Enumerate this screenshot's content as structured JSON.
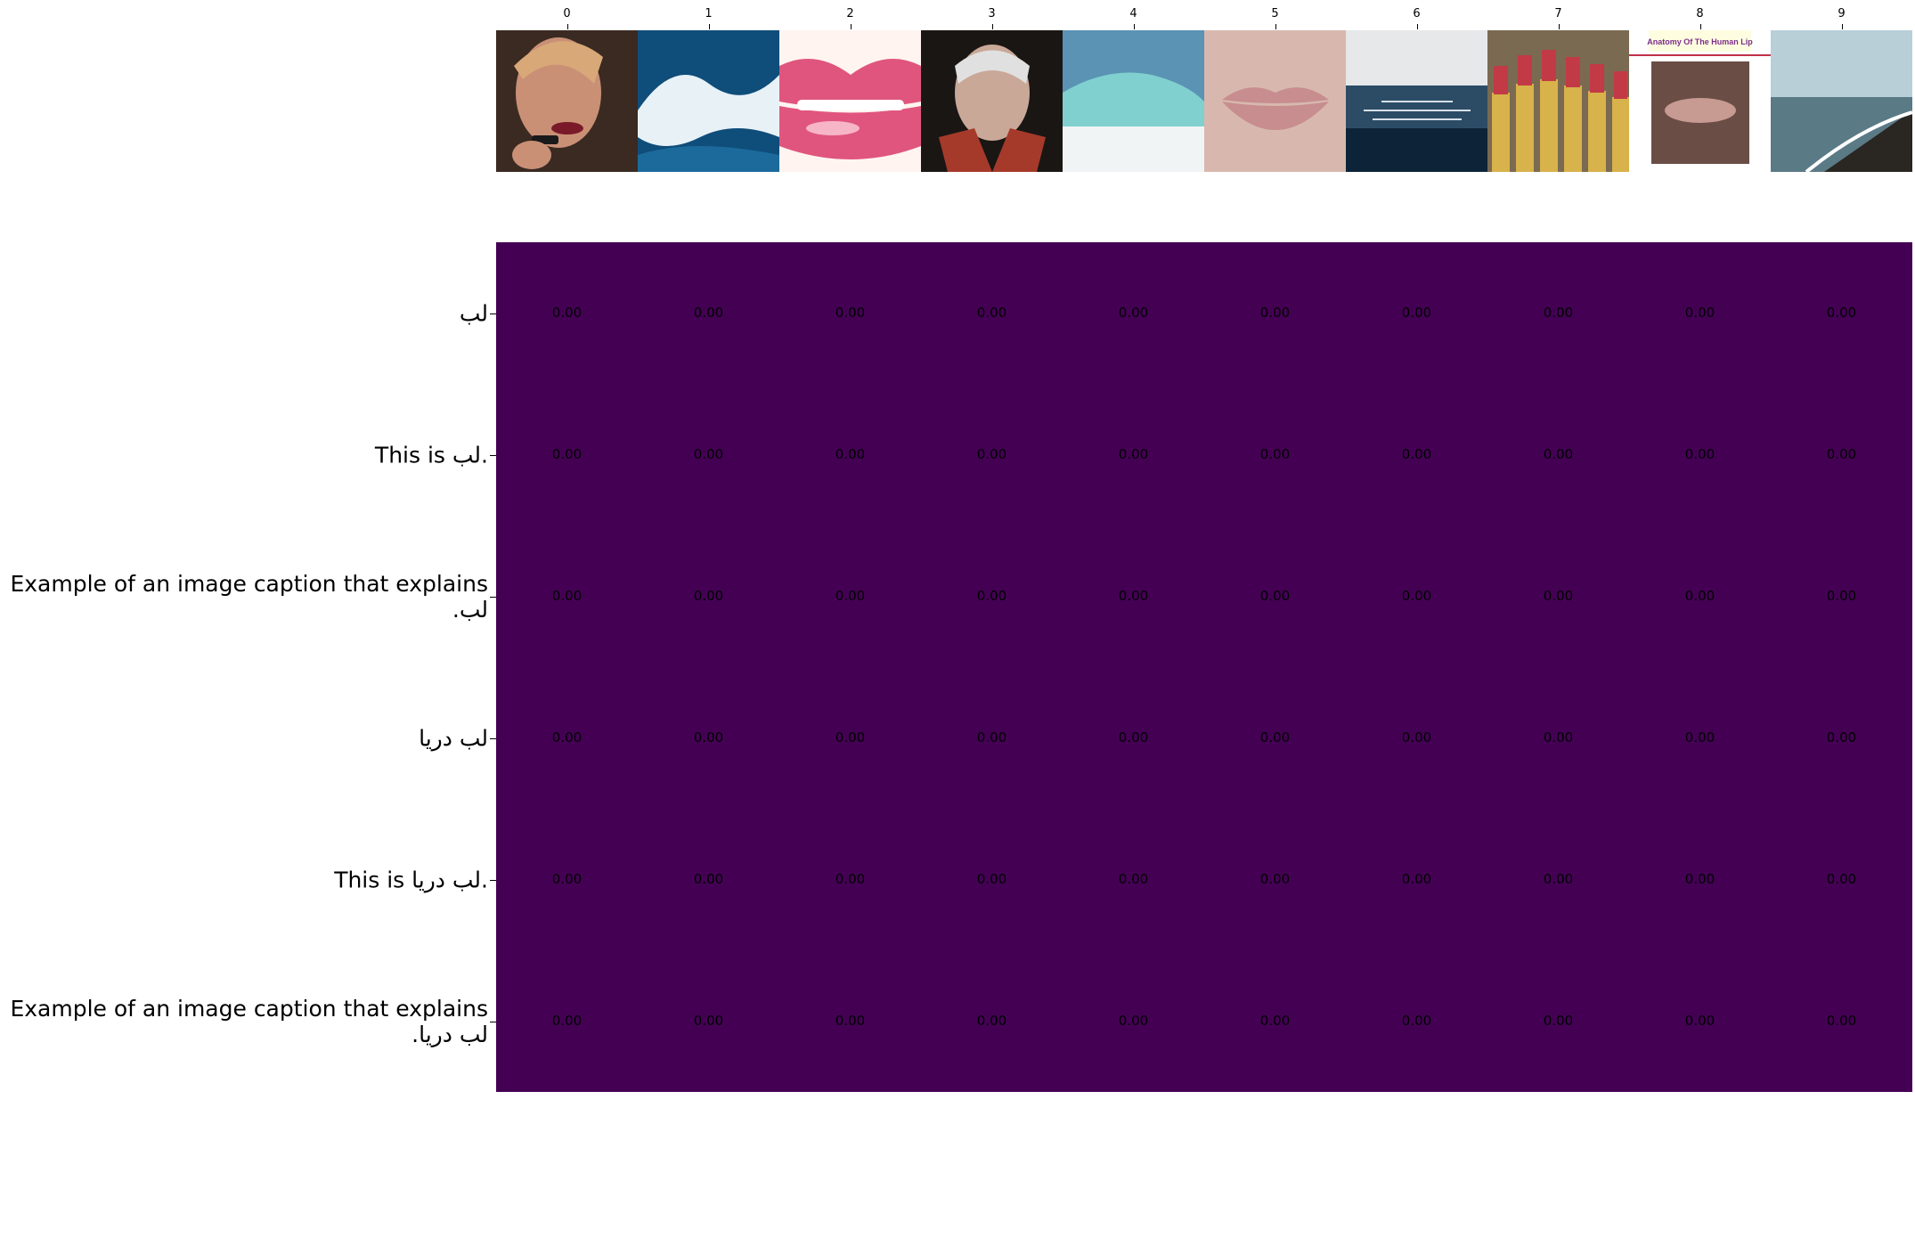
{
  "chart_data": {
    "type": "heatmap",
    "columns": [
      "0",
      "1",
      "2",
      "3",
      "4",
      "5",
      "6",
      "7",
      "8",
      "9"
    ],
    "column_images": [
      {
        "icon": "woman-applying-lipstick-photo",
        "colors": [
          "#3a2a22",
          "#c99076",
          "#7a1a28"
        ]
      },
      {
        "icon": "ocean-wave-photo",
        "colors": [
          "#0f4d7a",
          "#e8f1f6",
          "#1c6a9c"
        ]
      },
      {
        "icon": "pink-glossy-lips-photo",
        "colors": [
          "#fff4f0",
          "#e0557e",
          "#f7b6c8"
        ]
      },
      {
        "icon": "elderly-man-portrait-photo",
        "colors": [
          "#1a1614",
          "#c9a898",
          "#a63a2a"
        ]
      },
      {
        "icon": "turquoise-wave-photo",
        "colors": [
          "#5a93b4",
          "#7fd0cf",
          "#f1f4f4"
        ]
      },
      {
        "icon": "natural-lips-closeup-photo",
        "colors": [
          "#d8b8ae",
          "#c78d8f",
          "#e1c4ba"
        ]
      },
      {
        "icon": "sea-horizon-photo",
        "colors": [
          "#e6e8ea",
          "#2c4c66",
          "#0d2438"
        ]
      },
      {
        "icon": "lipstick-tubes-photo",
        "colors": [
          "#7a6a52",
          "#c23a46",
          "#d8b24a"
        ]
      },
      {
        "icon": "lip-anatomy-diagram",
        "title": "Anatomy Of The Human Lip",
        "colors": [
          "#fffde0",
          "#7b2d8b",
          "#c79a92"
        ]
      },
      {
        "icon": "beach-shoreline-photo",
        "colors": [
          "#b8cfd8",
          "#5a7a86",
          "#2a2622"
        ]
      }
    ],
    "rows": [
      "لب",
      "This is لب.",
      "Example of an image caption that explains\nلب.",
      "لب دریا",
      "This is لب دریا.",
      "Example of an image caption that explains\nلب دریا."
    ],
    "values": [
      [
        0,
        0,
        0,
        0,
        0,
        0,
        0,
        0,
        0,
        0
      ],
      [
        0,
        0,
        0,
        0,
        0,
        0,
        0,
        0,
        0,
        0
      ],
      [
        0,
        0,
        0,
        0,
        0,
        0,
        0,
        0,
        0,
        0
      ],
      [
        0,
        0,
        0,
        0,
        0,
        0,
        0,
        0,
        0,
        0
      ],
      [
        0,
        0,
        0,
        0,
        0,
        0,
        0,
        0,
        0,
        0
      ],
      [
        0,
        0,
        0,
        0,
        0,
        0,
        0,
        0,
        0,
        0
      ]
    ],
    "value_labels": [
      [
        "0.00",
        "0.00",
        "0.00",
        "0.00",
        "0.00",
        "0.00",
        "0.00",
        "0.00",
        "0.00",
        "0.00"
      ],
      [
        "0.00",
        "0.00",
        "0.00",
        "0.00",
        "0.00",
        "0.00",
        "0.00",
        "0.00",
        "0.00",
        "0.00"
      ],
      [
        "0.00",
        "0.00",
        "0.00",
        "0.00",
        "0.00",
        "0.00",
        "0.00",
        "0.00",
        "0.00",
        "0.00"
      ],
      [
        "0.00",
        "0.00",
        "0.00",
        "0.00",
        "0.00",
        "0.00",
        "0.00",
        "0.00",
        "0.00",
        "0.00"
      ],
      [
        "0.00",
        "0.00",
        "0.00",
        "0.00",
        "0.00",
        "0.00",
        "0.00",
        "0.00",
        "0.00",
        "0.00"
      ],
      [
        "0.00",
        "0.00",
        "0.00",
        "0.00",
        "0.00",
        "0.00",
        "0.00",
        "0.00",
        "0.00",
        "0.00"
      ]
    ],
    "colormap": "viridis",
    "cell_color": "#440154",
    "label_color": "#000000",
    "title": "",
    "xlabel": "",
    "ylabel": ""
  }
}
